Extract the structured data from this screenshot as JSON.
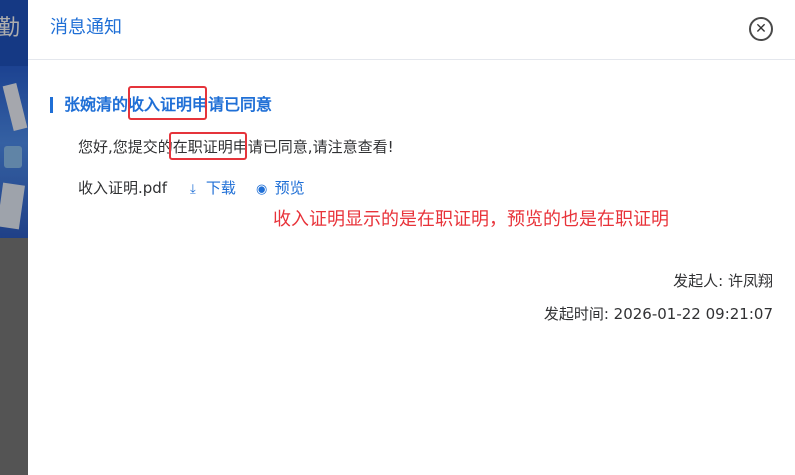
{
  "background": {
    "header_text": "勤"
  },
  "dialog": {
    "title": "消息通知",
    "close_icon": "close-circle-icon"
  },
  "notice": {
    "title_before": "张婉清的",
    "title_highlight": "收入证明",
    "title_after": "申请已同意",
    "body_before": "您好,您提交的",
    "body_highlight": "在职证明",
    "body_after": "申请已同意,请注意查看!"
  },
  "attachment": {
    "file_name": "收入证明.pdf",
    "download_label": "下载",
    "download_icon": "download-icon",
    "preview_label": "预览",
    "preview_icon": "eye-icon"
  },
  "annotation": {
    "text": "收入证明显示的是在职证明，预览的也是在职证明",
    "color": "#e8333a"
  },
  "meta": {
    "initiator": "发起人: 许凤翔",
    "time": "发起时间: 2026-01-22 09:21:07"
  },
  "colors": {
    "accent": "#1f6fd6",
    "annotation_red": "#e5343b"
  }
}
